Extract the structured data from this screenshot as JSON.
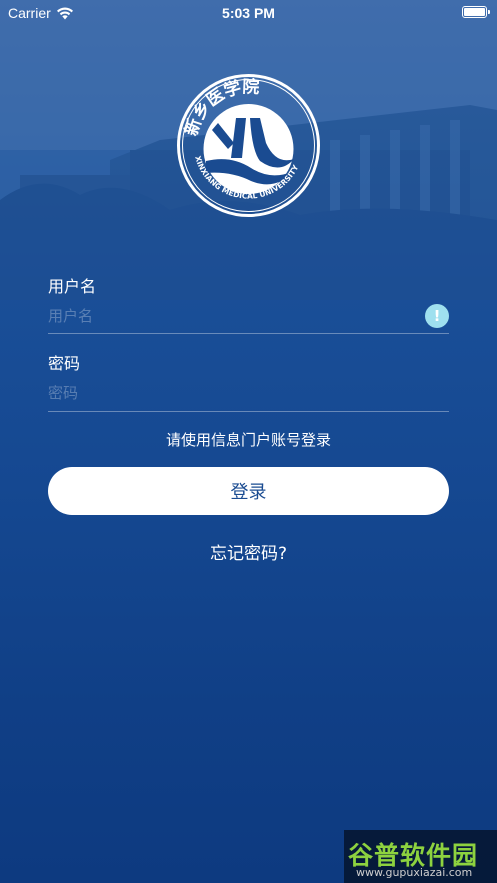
{
  "status_bar": {
    "carrier": "Carrier",
    "time": "5:03 PM",
    "icons": [
      "wifi-icon",
      "battery-icon"
    ]
  },
  "logo": {
    "chinese_name": "新乡医学院",
    "english_name": "XINXIANG MEDICAL UNIVERSITY"
  },
  "form": {
    "username_label": "用户名",
    "username_placeholder": "用户名",
    "username_value": "",
    "password_label": "密码",
    "password_placeholder": "密码",
    "password_value": "",
    "hint": "请使用信息门户账号登录",
    "login_button": "登录",
    "forgot_password": "忘记密码?",
    "warning_icon": "!"
  },
  "watermark": {
    "title": "谷普软件园",
    "url": "www.gupuxiazai.com"
  },
  "colors": {
    "background_top": "#2f5fa5",
    "background_bottom": "#0d3a80",
    "button_background": "#ffffff",
    "button_text": "#1a4b91",
    "warning_badge": "#9fe0ef"
  }
}
